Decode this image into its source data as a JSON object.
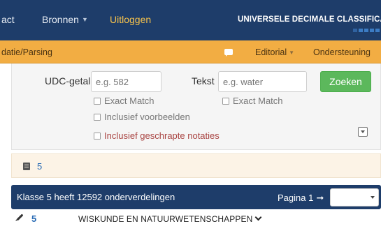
{
  "topbar": {
    "contact_label": "act",
    "bronnen_label": "Bronnen",
    "logout_label": "Uitloggen",
    "brand_text": "UNIVERSELE DECIMALE CLASSIFICATIE"
  },
  "subbar": {
    "validation_label": "datie/Parsing",
    "editorial_label": "Editorial",
    "support_label": "Ondersteuning"
  },
  "search": {
    "udc_label": "UDC-getal",
    "udc_placeholder": "e.g. 582",
    "text_label": "Tekst",
    "text_placeholder": "e.g. water",
    "submit_label": "Zoeken",
    "exact_match_udc": "Exact Match",
    "include_examples": "Inclusief voorbeelden",
    "include_cancelled": "Inclusief geschrapte notaties",
    "exact_match_text": "Exact Match"
  },
  "breadcrumb": {
    "link": "5"
  },
  "class_header": {
    "title": "Klasse 5 heeft 12592 onderverdelingen",
    "page_label": "Pagina 1",
    "page_arrow": "➞"
  },
  "results": [
    {
      "notation": "5",
      "title": "WISKUNDE EN NATUURWETENSCHAPPEN"
    }
  ],
  "colors": {
    "navbar": "#1e3d6a",
    "subbar": "#f2ad43",
    "logout": "#f5c24c",
    "search_button": "#5cb85c",
    "link": "#2a6cb5",
    "warning_text": "#a94442"
  }
}
